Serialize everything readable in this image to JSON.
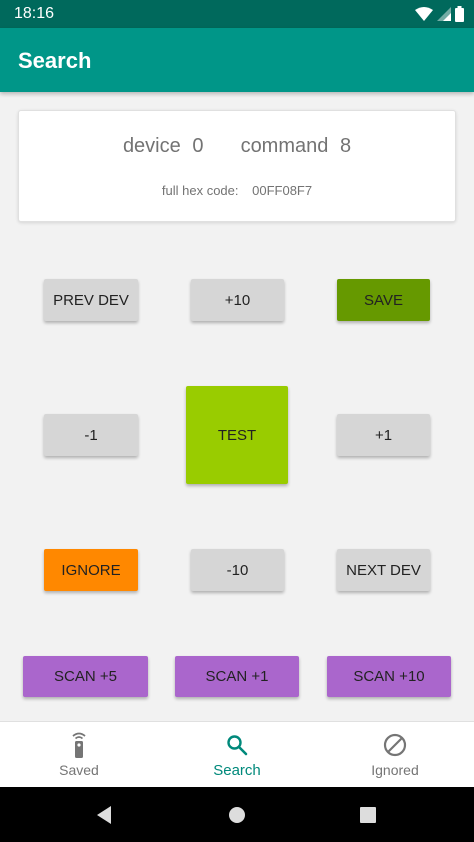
{
  "status_bar": {
    "time": "18:16"
  },
  "app_bar": {
    "title": "Search"
  },
  "info": {
    "device_label": "device",
    "device_value": "0",
    "command_label": "command",
    "command_value": "8",
    "hex_label": "full hex code:",
    "hex_value": "00FF08F7"
  },
  "buttons": {
    "prev_dev": "PREV DEV",
    "plus_10": "+10",
    "save": "SAVE",
    "minus_1": "-1",
    "test": "TEST",
    "plus_1": "+1",
    "ignore": "IGNORE",
    "minus_10": "-10",
    "next_dev": "NEXT DEV",
    "scan_5": "SCAN +5",
    "scan_1": "SCAN +1",
    "scan_10": "SCAN +10"
  },
  "bottom_nav": {
    "items": [
      {
        "label": "Saved",
        "icon": "remote-icon",
        "active": false
      },
      {
        "label": "Search",
        "icon": "search-icon",
        "active": true
      },
      {
        "label": "Ignored",
        "icon": "block-icon",
        "active": false
      }
    ]
  },
  "colors": {
    "primary": "#009688",
    "primary_dark": "#00695c",
    "save_green": "#669900",
    "test_green": "#99cc00",
    "ignore_orange": "#ff8800",
    "scan_purple": "#aa66cc",
    "neutral_button": "#d6d6d6"
  }
}
